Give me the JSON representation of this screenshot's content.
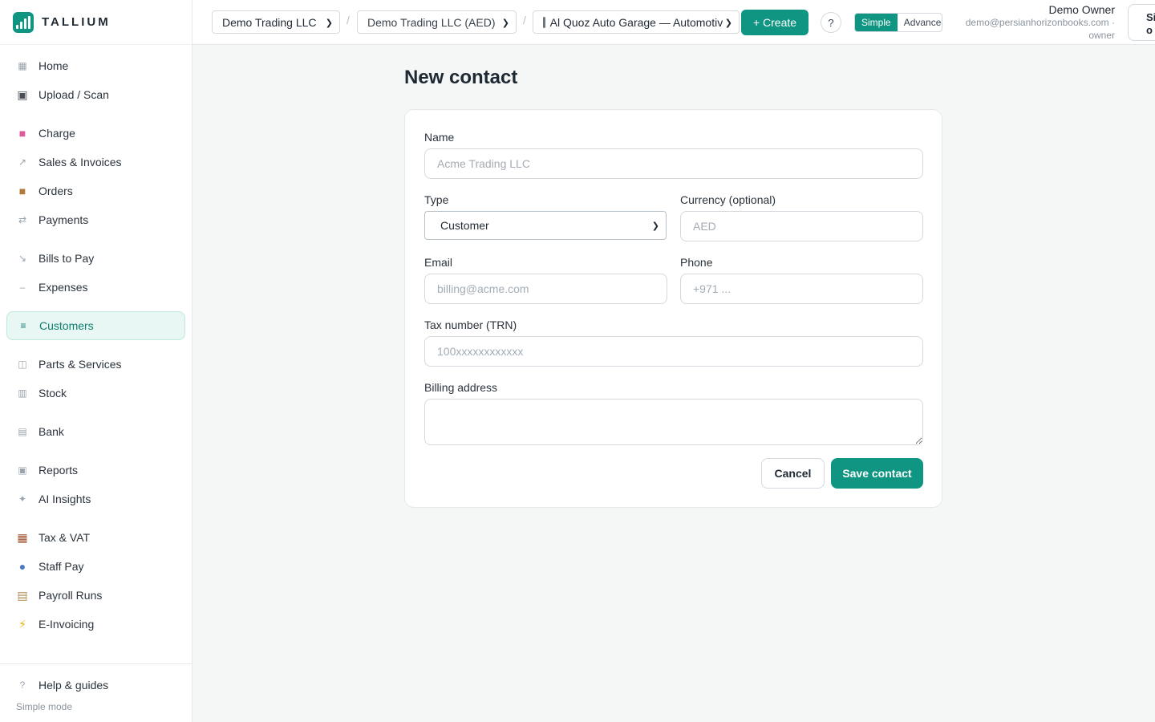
{
  "brand": {
    "name": "TALLIUM",
    "accent": "#0f9582"
  },
  "sidebar": {
    "groups": [
      [
        {
          "label": "Home",
          "icon": "grid-icon"
        },
        {
          "label": "Upload / Scan",
          "icon": "camera-icon"
        }
      ],
      [
        {
          "label": "Charge",
          "icon": "shopping-bag-icon"
        },
        {
          "label": "Sales & Invoices",
          "icon": "arrow-up-right-icon"
        },
        {
          "label": "Orders",
          "icon": "package-icon"
        },
        {
          "label": "Payments",
          "icon": "swap-arrows-icon"
        }
      ],
      [
        {
          "label": "Bills to Pay",
          "icon": "arrow-down-right-icon"
        },
        {
          "label": "Expenses",
          "icon": "minus-icon"
        }
      ],
      [
        {
          "label": "Customers",
          "icon": "list-icon",
          "active": true
        }
      ],
      [
        {
          "label": "Parts & Services",
          "icon": "columns-icon"
        },
        {
          "label": "Stock",
          "icon": "boxes-icon"
        }
      ],
      [
        {
          "label": "Bank",
          "icon": "bank-icon"
        }
      ],
      [
        {
          "label": "Reports",
          "icon": "report-icon"
        },
        {
          "label": "AI Insights",
          "icon": "sparkle-icon"
        }
      ],
      [
        {
          "label": "Tax & VAT",
          "icon": "abacus-icon"
        },
        {
          "label": "Staff Pay",
          "icon": "people-icon"
        },
        {
          "label": "Payroll Runs",
          "icon": "clipboard-icon"
        },
        {
          "label": "E-Invoicing",
          "icon": "lightning-icon"
        }
      ]
    ],
    "footer": {
      "help_label": "Help & guides",
      "mode_text": "Simple mode"
    }
  },
  "header": {
    "company_select": "Demo Trading LLC",
    "ledger_select": "Demo Trading LLC (AED)",
    "branch_select": "Al Quoz Auto Garage — Automotive",
    "create_label": "+ Create",
    "help_label": "?",
    "mode_simple": "Simple",
    "mode_advanced": "Advanced",
    "user_name": "Demo Owner",
    "user_email": "demo@persianhorizonbooks.com ·",
    "user_role": "owner",
    "signout_line1": "Si",
    "signout_line2": "o"
  },
  "form": {
    "title": "New contact",
    "name_label": "Name",
    "name_placeholder": "Acme Trading LLC",
    "type_label": "Type",
    "type_value": "Customer",
    "currency_label": "Currency (optional)",
    "currency_placeholder": "AED",
    "email_label": "Email",
    "email_placeholder": "billing@acme.com",
    "phone_label": "Phone",
    "phone_placeholder": "+971 ...",
    "tax_label": "Tax number (TRN)",
    "tax_placeholder": "100xxxxxxxxxxxx",
    "address_label": "Billing address",
    "cancel_label": "Cancel",
    "save_label": "Save contact"
  }
}
